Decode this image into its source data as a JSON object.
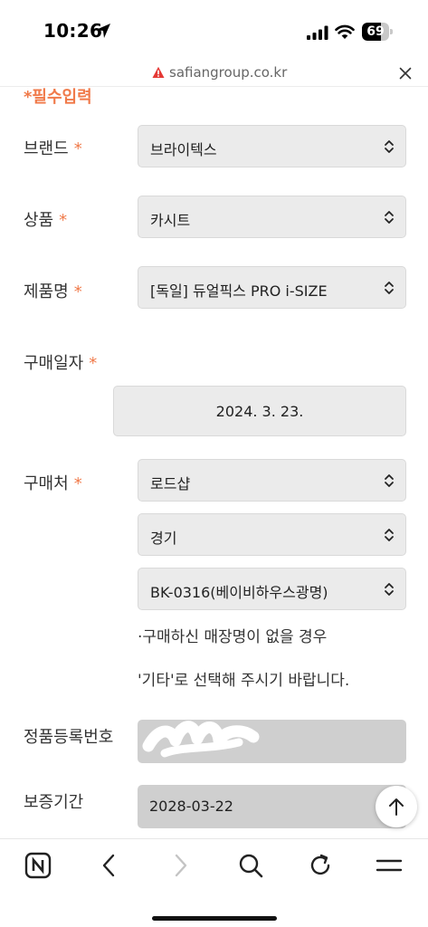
{
  "status_bar": {
    "time": "10:26",
    "battery_level": 69,
    "battery_text": "69"
  },
  "url_bar": {
    "domain": "safiangroup.co.kr"
  },
  "form": {
    "required_note": "*필수입력",
    "required_mark": "*",
    "brand": {
      "label": "브랜드",
      "value": "브라이텍스"
    },
    "product": {
      "label": "상품",
      "value": "카시트"
    },
    "product_name": {
      "label": "제품명",
      "value": "[독일] 듀얼픽스 PRO i-SIZE"
    },
    "purchase_date": {
      "label": "구매일자",
      "value": "2024. 3. 23."
    },
    "store": {
      "label": "구매처",
      "type_value": "로드샵",
      "region_value": "경기",
      "shop_value": "BK-0316(베이비하우스광명)",
      "help_line1": "·구매하신 매장명이 없을 경우",
      "help_line2": "'기타'로 선택해 주시기 바랍니다."
    },
    "registration_number": {
      "label": "정품등록번호"
    },
    "warranty_period": {
      "label": "보증기간",
      "value": "2028-03-22"
    }
  },
  "icons": {
    "location": "location-arrow-icon",
    "signal": "cellular-signal-icon",
    "wifi": "wifi-icon",
    "warning": "warning-triangle-icon",
    "close": "close-icon",
    "chevron": "chevron-up-down-icon",
    "scroll_top": "arrow-up-icon",
    "naver": "naver-n-icon",
    "back": "chevron-left-icon",
    "forward": "chevron-right-icon",
    "search": "search-icon",
    "refresh": "refresh-icon",
    "menu": "menu-icon"
  },
  "colors": {
    "accent": "#f07a4a",
    "warning": "#e53935"
  }
}
